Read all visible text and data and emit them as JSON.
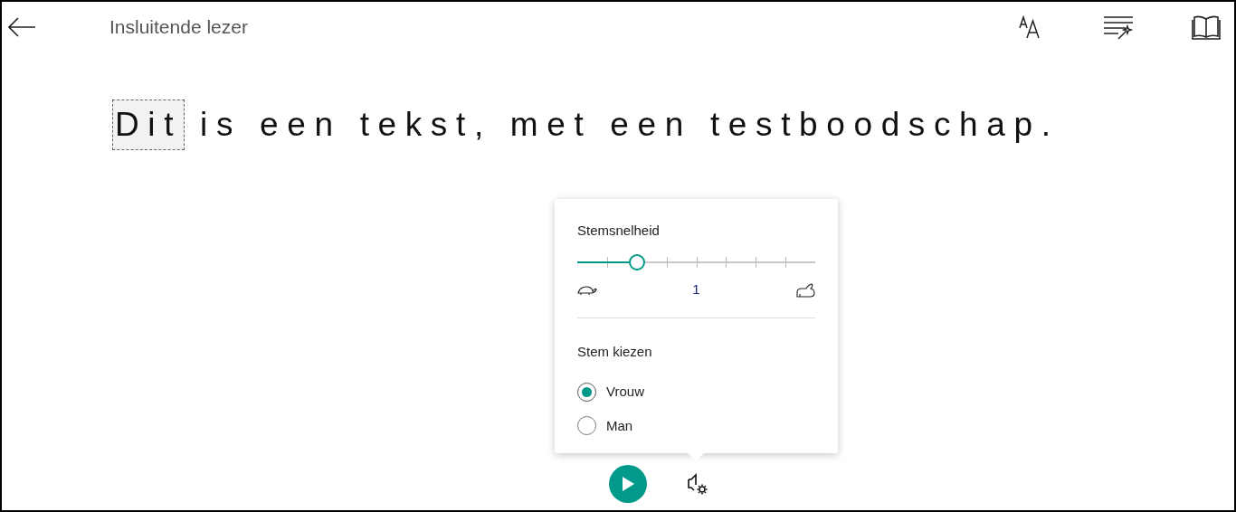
{
  "header": {
    "title": "Insluitende lezer"
  },
  "sentence": [
    {
      "text": "Dit",
      "selected": true
    },
    {
      "text": "is",
      "selected": false
    },
    {
      "text": "een",
      "selected": false
    },
    {
      "text": "tekst,",
      "selected": false
    },
    {
      "text": "met",
      "selected": false
    },
    {
      "text": "een",
      "selected": false
    },
    {
      "text": "testboodschap.",
      "selected": false
    }
  ],
  "voice_panel": {
    "speed_label": "Stemsnelheid",
    "speed": {
      "level": 0.25,
      "reading": "1"
    },
    "voice_label": "Stem kiezen",
    "voices": [
      {
        "label": "Vrouw",
        "selected": true
      },
      {
        "label": "Man",
        "selected": false
      }
    ]
  }
}
